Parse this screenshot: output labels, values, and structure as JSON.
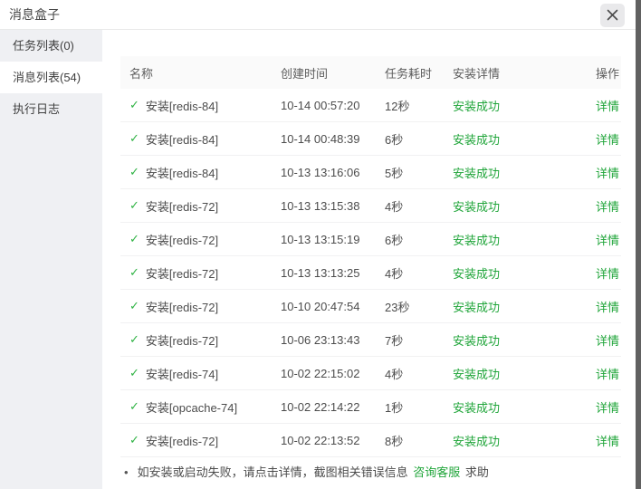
{
  "dialog": {
    "title": "消息盒子"
  },
  "sidebar": {
    "items": [
      {
        "label": "任务列表(0)"
      },
      {
        "label": "消息列表(54)"
      },
      {
        "label": "执行日志"
      }
    ]
  },
  "table": {
    "headers": [
      "名称",
      "创建时间",
      "任务耗时",
      "安装详情",
      "操作"
    ],
    "rows": [
      {
        "name": "安装[redis-84]",
        "created": "10-14 00:57:20",
        "duration": "12秒",
        "status": "安装成功",
        "action": "详情"
      },
      {
        "name": "安装[redis-84]",
        "created": "10-14 00:48:39",
        "duration": "6秒",
        "status": "安装成功",
        "action": "详情"
      },
      {
        "name": "安装[redis-84]",
        "created": "10-13 13:16:06",
        "duration": "5秒",
        "status": "安装成功",
        "action": "详情"
      },
      {
        "name": "安装[redis-72]",
        "created": "10-13 13:15:38",
        "duration": "4秒",
        "status": "安装成功",
        "action": "详情"
      },
      {
        "name": "安装[redis-72]",
        "created": "10-13 13:15:19",
        "duration": "6秒",
        "status": "安装成功",
        "action": "详情"
      },
      {
        "name": "安装[redis-72]",
        "created": "10-13 13:13:25",
        "duration": "4秒",
        "status": "安装成功",
        "action": "详情"
      },
      {
        "name": "安装[redis-72]",
        "created": "10-10 20:47:54",
        "duration": "23秒",
        "status": "安装成功",
        "action": "详情"
      },
      {
        "name": "安装[redis-72]",
        "created": "10-06 23:13:43",
        "duration": "7秒",
        "status": "安装成功",
        "action": "详情"
      },
      {
        "name": "安装[redis-74]",
        "created": "10-02 22:15:02",
        "duration": "4秒",
        "status": "安装成功",
        "action": "详情"
      },
      {
        "name": "安装[opcache-74]",
        "created": "10-02 22:14:22",
        "duration": "1秒",
        "status": "安装成功",
        "action": "详情"
      },
      {
        "name": "安装[redis-72]",
        "created": "10-02 22:13:52",
        "duration": "8秒",
        "status": "安装成功",
        "action": "详情"
      }
    ]
  },
  "footer": {
    "bullet": "•",
    "note": "如安装或启动失败，请点击详情，截图相关错误信息",
    "link": "咨询客服",
    "suffix": "求助"
  },
  "colors": {
    "green": "#20a53a",
    "check_green": "#30b345",
    "sidebar_bg": "#eff0f3",
    "header_bg": "#fafafa",
    "edge_strip": "#616161"
  }
}
